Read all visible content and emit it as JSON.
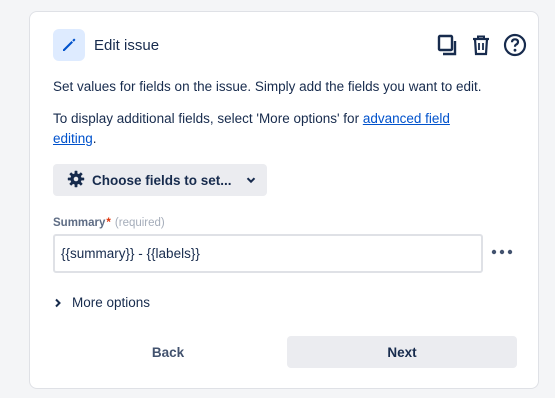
{
  "header": {
    "title": "Edit issue"
  },
  "description": {
    "line1": "Set values for fields on the issue. Simply add the fields you want to edit.",
    "line2_prefix": "To display additional fields, select 'More options' for ",
    "line2_link": "advanced field editing",
    "line2_suffix": "."
  },
  "choose_fields": {
    "label": "Choose fields to set..."
  },
  "summary_field": {
    "label": "Summary",
    "required_marker": "*",
    "required_text": "(required)",
    "value": "{{summary}} - {{labels}}"
  },
  "more_options": {
    "label": "More options"
  },
  "footer": {
    "back_label": "Back",
    "next_label": "Next"
  },
  "colors": {
    "accent": "#0052cc",
    "header_icon_bg": "#deebff",
    "button_bg": "#ebecf0",
    "required": "#de350b"
  },
  "icons": {
    "header": "pencil-icon",
    "copy": "copy-icon",
    "delete": "trash-icon",
    "help": "help-icon",
    "choose_fields": "gear-icon",
    "dropdown": "chevron-down-icon",
    "field_more": "ellipsis-icon",
    "more_options": "chevron-right-icon"
  }
}
